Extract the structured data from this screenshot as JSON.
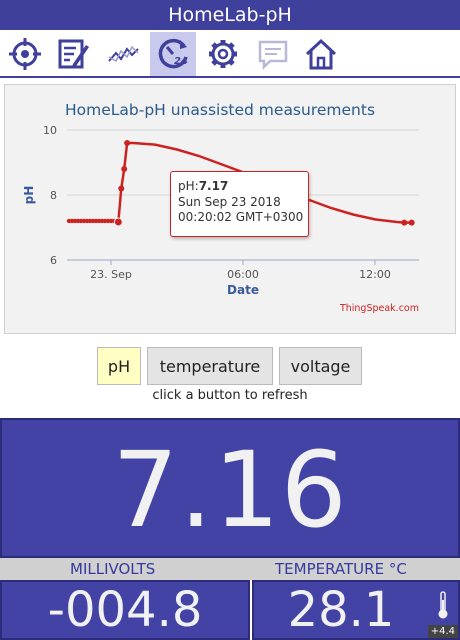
{
  "app": {
    "title": "HomeLab-pH"
  },
  "toolbar": {
    "items": [
      {
        "icon": "crosshair-icon"
      },
      {
        "icon": "edit-notes-icon"
      },
      {
        "icon": "chart-trend-icon"
      },
      {
        "icon": "history-24h-icon",
        "badge": "24",
        "active": true
      },
      {
        "icon": "gear-icon"
      },
      {
        "icon": "chat-icon",
        "disabled": true
      },
      {
        "icon": "home-icon"
      }
    ]
  },
  "chart_data": {
    "type": "line",
    "title": "HomeLab-pH unassisted measurements",
    "xlabel": "Date",
    "ylabel": "pH",
    "ylim": [
      6,
      10
    ],
    "yticks": [
      "6",
      "8",
      "10"
    ],
    "xticks": [
      "23. Sep",
      "06:00",
      "12:00"
    ],
    "credit": "ThingSpeak.com",
    "grid": true,
    "series": [
      {
        "color": "#cc2222",
        "x": [
          "2018-09-22 22:40",
          "2018-09-22 23:00",
          "2018-09-22 23:20",
          "2018-09-22 23:40",
          "2018-09-23 00:00",
          "2018-09-23 00:20",
          "2018-09-23 00:28",
          "2018-09-23 00:36",
          "2018-09-23 00:44",
          "2018-09-23 01:00",
          "2018-09-23 02:00",
          "2018-09-23 03:00",
          "2018-09-23 04:00",
          "2018-09-23 05:00",
          "2018-09-23 06:00",
          "2018-09-23 07:00",
          "2018-09-23 08:00",
          "2018-09-23 09:00",
          "2018-09-23 10:00",
          "2018-09-23 11:00",
          "2018-09-23 12:00",
          "2018-09-23 13:00",
          "2018-09-23 13:20",
          "2018-09-23 13:40"
        ],
        "y": [
          7.2,
          7.2,
          7.2,
          7.2,
          7.2,
          7.17,
          8.2,
          8.8,
          9.6,
          9.6,
          9.55,
          9.4,
          9.2,
          8.95,
          8.7,
          8.4,
          8.1,
          7.85,
          7.6,
          7.4,
          7.25,
          7.17,
          7.15,
          7.15
        ]
      }
    ]
  },
  "tooltip": {
    "label": "pH:",
    "value": "7.17",
    "date": "Sun Sep 23 2018",
    "time": "00:20:02 GMT+0300"
  },
  "buttons": {
    "ph": "pH",
    "temperature": "temperature",
    "voltage": "voltage",
    "active": "ph",
    "hint": "click a button to refresh"
  },
  "readout": {
    "main_value": "7.16",
    "millivolts_label": "MILLIVOLTS",
    "temperature_label": "TEMPERATURE °C",
    "millivolts_value": "-004.8",
    "temperature_value": "28.1",
    "temperature_delta": "+4.4"
  },
  "colors": {
    "panel": "#4343a6",
    "header": "#3f3f9c",
    "series": "#cc2222",
    "active_button": "#ffffc4"
  }
}
